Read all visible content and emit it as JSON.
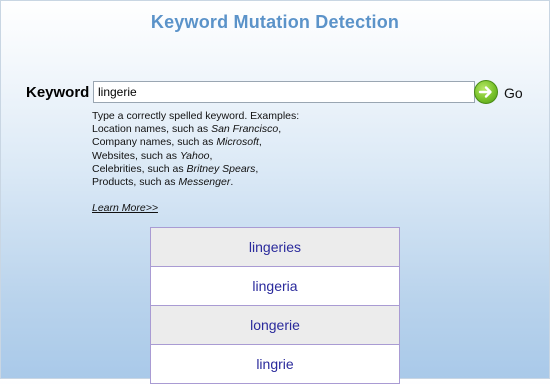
{
  "page": {
    "title": "Keyword Mutation Detection"
  },
  "search": {
    "label": "Keyword",
    "value": "lingerie",
    "go_label": "Go",
    "go_icon": "arrow-right-icon",
    "go_color": "#79c22a"
  },
  "help": {
    "intro": "Type a correctly spelled keyword. Examples:",
    "examples": [
      {
        "prefix": "Location names, such as ",
        "example": "San Francisco",
        "suffix": ","
      },
      {
        "prefix": "Company names, such as ",
        "example": "Microsoft",
        "suffix": ","
      },
      {
        "prefix": "Websites, such as ",
        "example": "Yahoo",
        "suffix": ","
      },
      {
        "prefix": "Celebrities, such as ",
        "example": "Britney Spears",
        "suffix": ","
      },
      {
        "prefix": "Products, such as ",
        "example": "Messenger",
        "suffix": "."
      }
    ],
    "learn_more": "Learn More>>"
  },
  "results": {
    "items": [
      "lingeries",
      "lingeria",
      "longerie",
      "lingrie"
    ],
    "text_color": "#2a2a9c",
    "border_color": "#a99bd3"
  }
}
